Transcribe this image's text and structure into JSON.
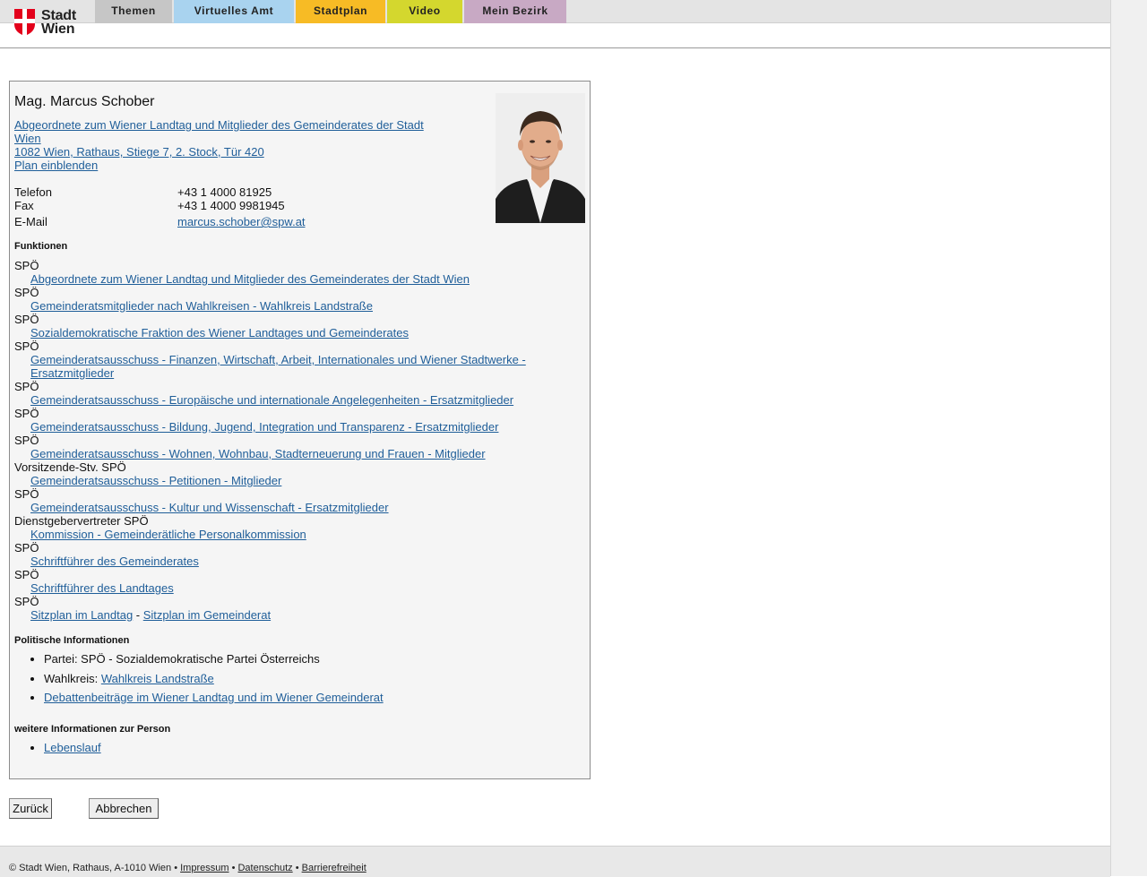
{
  "header": {
    "logo_line1": "Stadt",
    "logo_line2": "Wien",
    "nav": [
      {
        "label": "Themen",
        "color": "#c6c6c6",
        "width": 86
      },
      {
        "label": "Virtuelles Amt",
        "color": "#a9d3ef",
        "width": 134
      },
      {
        "label": "Stadtplan",
        "color": "#f7bb25",
        "width": 100
      },
      {
        "label": "Video",
        "color": "#d4d72e",
        "width": 84
      },
      {
        "label": "Mein Bezirk",
        "color": "#c8a9c4",
        "width": 114
      }
    ]
  },
  "person": {
    "name": "Mag. Marcus Schober",
    "position_line1": "Abgeordnete zum Wiener Landtag und Mitglieder des Gemeinderates der Stadt",
    "position_line2": "Wien ",
    "address": "1082 Wien, Rathaus, Stiege 7, 2. Stock, Tür 420",
    "plan_link": "Plan einblenden",
    "contact": {
      "phone_label": "Telefon",
      "phone": "+43 1 4000 81925",
      "fax_label": "Fax",
      "fax": "+43 1 4000 9981945",
      "email_label": "E-Mail",
      "email": "marcus.schober@spw.at"
    }
  },
  "functions": {
    "title": "Funktionen",
    "items": [
      {
        "role": "SPÖ",
        "link": "Abgeordnete zum Wiener Landtag und Mitglieder des Gemeinderates der Stadt Wien"
      },
      {
        "role": "SPÖ",
        "link": "Gemeinderatsmitglieder nach Wahlkreisen - Wahlkreis Landstraße"
      },
      {
        "role": "SPÖ",
        "link": "Sozialdemokratische Fraktion des Wiener Landtages und Gemeinderates"
      },
      {
        "role": "SPÖ",
        "link": "Gemeinderatsausschuss - Finanzen, Wirtschaft, Arbeit, Internationales und Wiener Stadtwerke - Ersatzmitglieder"
      },
      {
        "role": "SPÖ",
        "link": "Gemeinderatsausschuss - Europäische und internationale Angelegenheiten - Ersatzmitglieder"
      },
      {
        "role": "SPÖ",
        "link": "Gemeinderatsausschuss - Bildung, Jugend, Integration und Transparenz - Ersatzmitglieder"
      },
      {
        "role": "SPÖ",
        "link": "Gemeinderatsausschuss - Wohnen, Wohnbau, Stadterneuerung und Frauen - Mitglieder"
      },
      {
        "role": "Vorsitzende-Stv. SPÖ",
        "link": "Gemeinderatsausschuss - Petitionen - Mitglieder"
      },
      {
        "role": "SPÖ",
        "link": "Gemeinderatsausschuss - Kultur und Wissenschaft - Ersatzmitglieder"
      },
      {
        "role": "Dienstgebervertreter SPÖ",
        "link": "Kommission - Gemeinderätliche Personalkommission"
      },
      {
        "role": "SPÖ",
        "link": "Schriftführer des Gemeinderates"
      },
      {
        "role": "SPÖ",
        "link": "Schriftführer des Landtages"
      }
    ],
    "last_role": "SPÖ",
    "seat_landtag": "Sitzplan im Landtag",
    "seat_separator": " - ",
    "seat_gemeinderat": "Sitzplan im Gemeinderat"
  },
  "political": {
    "title": "Politische Informationen",
    "party": "Partei: SPÖ - Sozialdemokratische Partei Österreichs",
    "district_prefix": "Wahlkreis: ",
    "district_link": "Wahlkreis Landstraße",
    "debates_link": "Debattenbeiträge im Wiener Landtag und im Wiener Gemeinderat"
  },
  "more_info": {
    "title": "weitere Informationen zur Person",
    "cv_link": "Lebenslauf"
  },
  "buttons": {
    "back": "Zurück",
    "cancel": "Abbrechen"
  },
  "footer": {
    "copyright": "© Stadt Wien, Rathaus, A-1010 Wien",
    "sep": " • ",
    "impressum": "Impressum",
    "datenschutz": "Datenschutz",
    "barrierefreiheit": "Barrierefreiheit"
  }
}
